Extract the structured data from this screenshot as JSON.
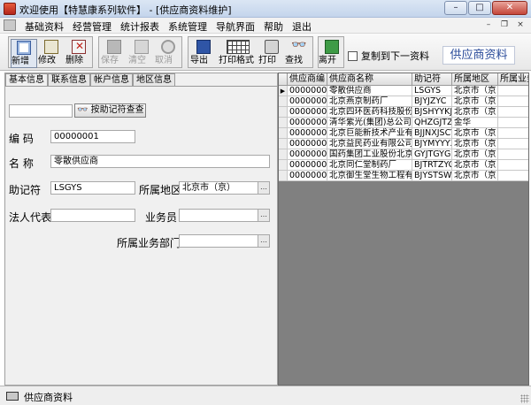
{
  "window": {
    "title": "欢迎使用【特慧康系列软件】 - [供应商资料维护]",
    "minimize": "–",
    "maximize": "□",
    "close": "✕"
  },
  "menu": {
    "items": [
      "基础资料",
      "经营管理",
      "统计报表",
      "系统管理",
      "导航界面",
      "帮助",
      "退出"
    ],
    "mdi_minimize": "–",
    "mdi_restore": "❐",
    "mdi_close": "×"
  },
  "toolbar": {
    "new": "新增",
    "edit": "修改",
    "delete": "删除",
    "save": "保存",
    "clear": "清空",
    "cancel": "取消",
    "export": "导出",
    "print_format": "打印格式",
    "print": "打印",
    "find": "查找",
    "exit": "离开",
    "copy_to_next": "复制到下一资料",
    "module_title": "供应商资料"
  },
  "tabs": [
    "基本信息",
    "联系信息",
    "帐户信息",
    "地区信息"
  ],
  "form": {
    "mnemonic_search_value": "",
    "mnemonic_search_button": "按助记符查查",
    "code_label": "编  码",
    "code_value": "00000001",
    "name_label": "名  称",
    "name_value": "零散供应商",
    "mnemonic_label": "助记符",
    "mnemonic_value": "LSGYS",
    "region_label": "所属地区",
    "region_value": "北京市（京）",
    "legal_rep_label": "法人代表",
    "legal_rep_value": "",
    "salesman_label": "业务员",
    "salesman_value": "",
    "dept_label": "所属业务部门",
    "dept_value": "",
    "ellipsis": "…"
  },
  "grid": {
    "columns": [
      "供应商编",
      "供应商名称",
      "助记符",
      "所属地区",
      "所属业务"
    ],
    "rows": [
      [
        "00000001",
        "零散供应商",
        "LSGYS",
        "北京市（京",
        ""
      ],
      [
        "00000002",
        "北京燕京制药厂",
        "BJYJZYC",
        "北京市（京",
        ""
      ],
      [
        "00000003",
        "北京四环医药科技股份",
        "BJSHYYKJ",
        "北京市（京",
        ""
      ],
      [
        "00000004",
        "清华紫光(集团)总公司",
        "QHZGJTZG",
        "金华",
        ""
      ],
      [
        "00000005",
        "北京巨能新技术产业有",
        "BJJNXJSCY",
        "北京市（京",
        ""
      ],
      [
        "00000006",
        "北京益民药业有限公司",
        "BJYMYYYX",
        "北京市（京",
        ""
      ],
      [
        "00000007",
        "国药集团工业股份北京",
        "GYJTGYGF",
        "北京市（京",
        ""
      ],
      [
        "00000008",
        "北京同仁堂制药厂",
        "BJTRTZYC",
        "北京市（京",
        ""
      ],
      [
        "00000009",
        "北京御生堂生物工程有",
        "BJYSTSWG",
        "北京市（京",
        ""
      ]
    ],
    "current_row_marker": "▶"
  },
  "status": {
    "text": "供应商资料"
  },
  "colors": {
    "module_title": "#2b4c9a",
    "grid_background": "#808080"
  }
}
